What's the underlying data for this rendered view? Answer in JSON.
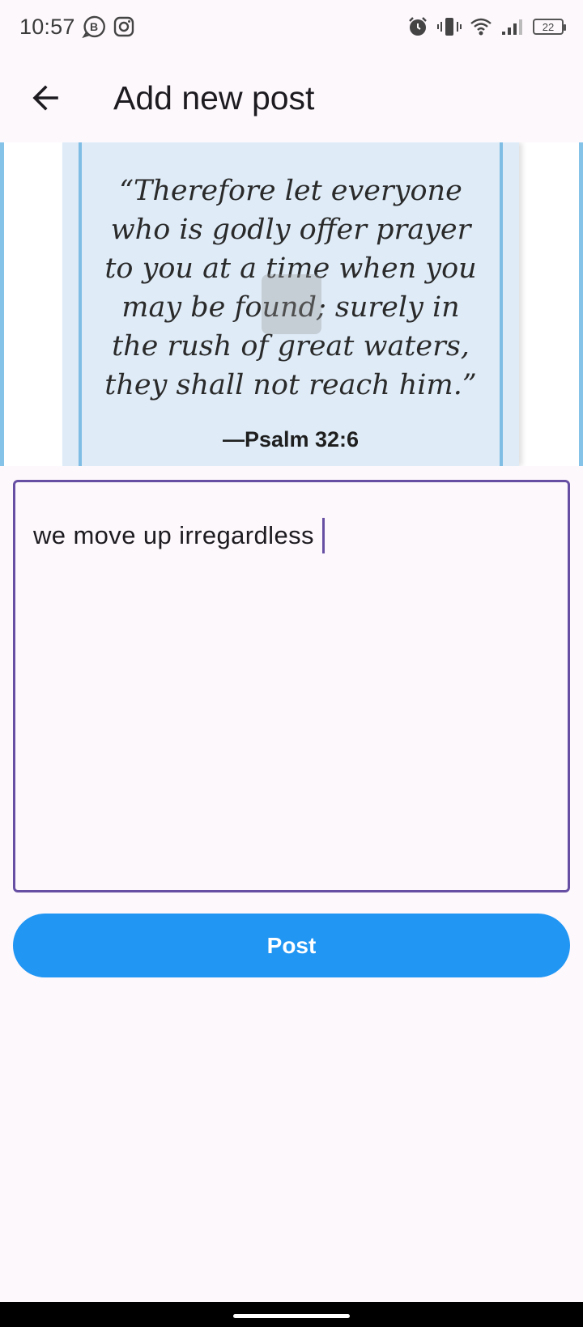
{
  "status_bar": {
    "time": "10:57",
    "battery": "22",
    "icons": [
      "b-badge-icon",
      "instagram-icon",
      "alarm-icon",
      "vibrate-icon",
      "wifi-icon",
      "signal-icon",
      "battery-icon"
    ]
  },
  "app_bar": {
    "title": "Add new post",
    "back_icon": "arrow-left-icon"
  },
  "image": {
    "quote": "“Therefore let everyone\nwho is godly offer prayer\nto you at a time when you\nmay be found; surely in\nthe rush of great waters,\nthey shall not reach him.”",
    "reference": "—Psalm 32:6"
  },
  "text_field": {
    "value": "we move up irregardless"
  },
  "post_button": {
    "label": "Post"
  },
  "colors": {
    "accent": "#6750a4",
    "button": "#2196f3",
    "background": "#fdf8fc",
    "card": "#dfecf8"
  }
}
